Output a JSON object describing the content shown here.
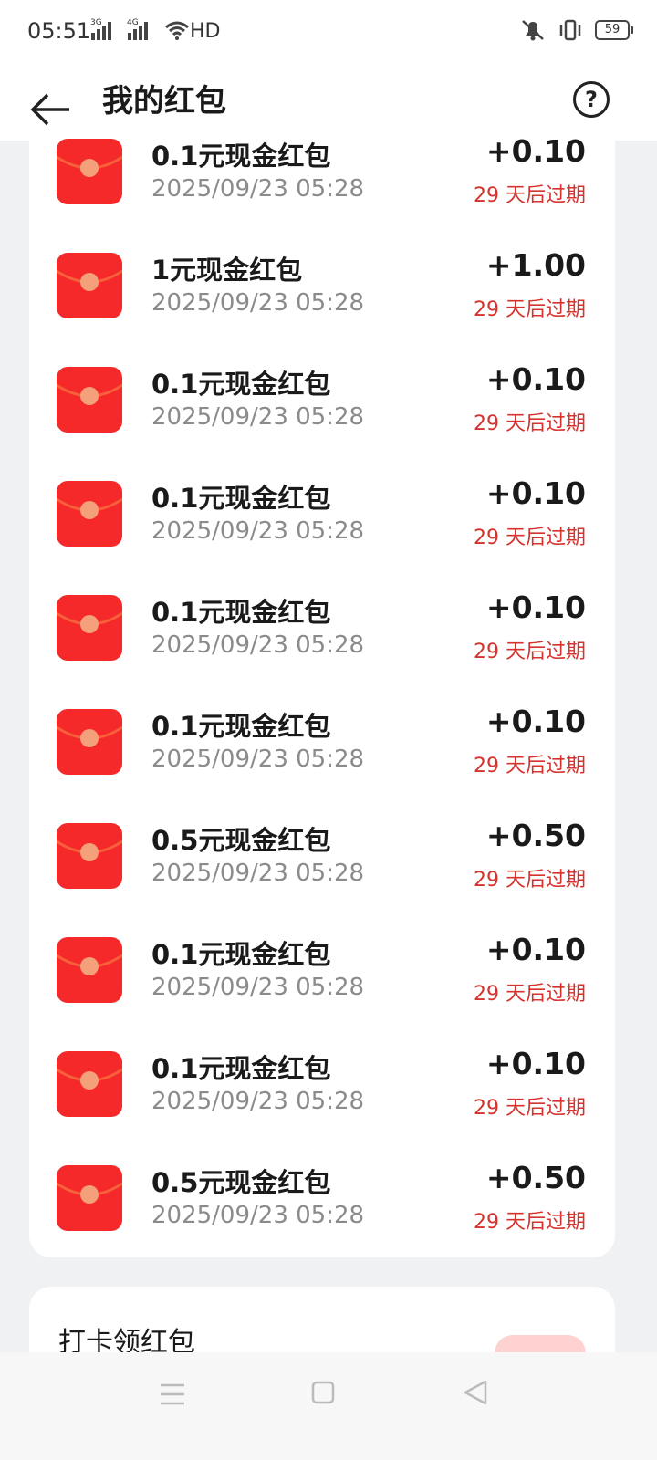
{
  "status_bar": {
    "time": "05:51",
    "network_1": "3G",
    "network_2": "4G",
    "hd": "HD",
    "battery": "59"
  },
  "header": {
    "title": "我的红包",
    "help_icon": "question-circle-icon",
    "back_icon": "arrow-left-icon"
  },
  "colors": {
    "envelope_red": "#f5282a",
    "expire_red": "#d6322e",
    "seal_gold": "#f3a07b"
  },
  "items": [
    {
      "title": "0.1元现金红包",
      "date": "2025/09/23 05:28",
      "amount": "+0.10",
      "expire": "29 天后过期"
    },
    {
      "title": "1元现金红包",
      "date": "2025/09/23 05:28",
      "amount": "+1.00",
      "expire": "29 天后过期"
    },
    {
      "title": "0.1元现金红包",
      "date": "2025/09/23 05:28",
      "amount": "+0.10",
      "expire": "29 天后过期"
    },
    {
      "title": "0.1元现金红包",
      "date": "2025/09/23 05:28",
      "amount": "+0.10",
      "expire": "29 天后过期"
    },
    {
      "title": "0.1元现金红包",
      "date": "2025/09/23 05:28",
      "amount": "+0.10",
      "expire": "29 天后过期"
    },
    {
      "title": "0.1元现金红包",
      "date": "2025/09/23 05:28",
      "amount": "+0.10",
      "expire": "29 天后过期"
    },
    {
      "title": "0.5元现金红包",
      "date": "2025/09/23 05:28",
      "amount": "+0.50",
      "expire": "29 天后过期"
    },
    {
      "title": "0.1元现金红包",
      "date": "2025/09/23 05:28",
      "amount": "+0.10",
      "expire": "29 天后过期"
    },
    {
      "title": "0.1元现金红包",
      "date": "2025/09/23 05:28",
      "amount": "+0.10",
      "expire": "29 天后过期"
    },
    {
      "title": "0.5元现金红包",
      "date": "2025/09/23 05:28",
      "amount": "+0.50",
      "expire": "29 天后过期"
    }
  ],
  "checkin": {
    "title": "打卡领红包"
  },
  "nav": {
    "menu_icon": "menu-icon",
    "home_icon": "square-home-icon",
    "back_icon": "triangle-back-icon"
  }
}
